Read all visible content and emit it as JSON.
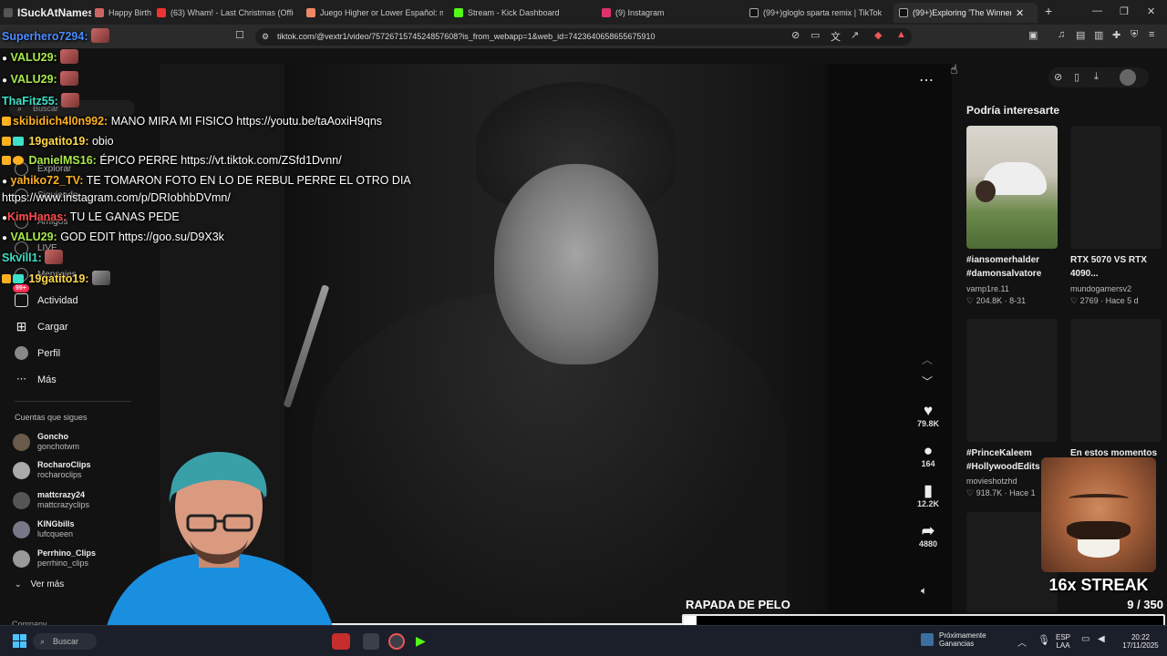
{
  "browser": {
    "tabs": [
      {
        "label": "ISuckAtNames:",
        "color": "#f0f0f0"
      },
      {
        "label": "Happy Birth",
        "color": "#c9c9c9"
      },
      {
        "label": "(63) Wham! - Last Christmas (Officia",
        "color": "#e33"
      },
      {
        "label": "Juego Higher or Lower Español: más",
        "color": "#e86"
      },
      {
        "label": "Stream - Kick Dashboard",
        "color": "#53fc18"
      },
      {
        "label": "(9) Instagram",
        "color": "#e1306c"
      },
      {
        "label": "(99+)gloglo sparta remix | TikTok",
        "color": "#fff"
      },
      {
        "label": "(99+)Exploring 'The Winner",
        "color": "#fff"
      }
    ],
    "url": "tiktok.com/@vextr1/video/7572671574524857608?is_from_webapp=1&web_id=7423640658655675910"
  },
  "chat": [
    {
      "user": "Superhero7294:",
      "color": "#4d8cff",
      "text": ""
    },
    {
      "user": "VALU29:",
      "color": "#a8e84a",
      "text": ""
    },
    {
      "user": "VALU29:",
      "color": "#a8e84a",
      "text": ""
    },
    {
      "user": "ThaFitz55:",
      "color": "#3de0c8",
      "text": ""
    },
    {
      "user": "skibidich4l0n992:",
      "color": "#ffb020",
      "text": "MANO MIRA MI FISICO https://youtu.be/taAoxiH9qns"
    },
    {
      "user": "19gatito19:",
      "color": "#ffd84a",
      "text": "obio"
    },
    {
      "user": "DanielMS16:",
      "color": "#a8e84a",
      "text": "ÉPICO PERRE https://vt.tiktok.com/ZSfd1Dvnn/"
    },
    {
      "user": "yahiko72_TV:",
      "color": "#ffb020",
      "text": "TE TOMARON FOTO EN LO DE REBUL PERRE EL OTRO DIA"
    },
    {
      "user": "",
      "color": "#fff",
      "text": "https://www.instagram.com/p/DRIobhbDVmn/"
    },
    {
      "user": "KimHanas:",
      "color": "#ff4a4a",
      "text": "TU LE GANAS PEDE"
    },
    {
      "user": "VALU29:",
      "color": "#a8e84a",
      "text": "GOD EDIT https://goo.su/D9X3k"
    },
    {
      "user": "Skvill1:",
      "color": "#3de0c8",
      "text": ""
    },
    {
      "user": "19gatito19:",
      "color": "#ffd84a",
      "text": ""
    }
  ],
  "sidebar": {
    "search_placeholder": "Buscar",
    "items": [
      {
        "label": "Explorar"
      },
      {
        "label": "Siguiendo"
      },
      {
        "label": "Amigos"
      },
      {
        "label": "LIVE"
      },
      {
        "label": "Mensajes"
      },
      {
        "label": "Actividad",
        "badge": "99+"
      },
      {
        "label": "Cargar"
      },
      {
        "label": "Perfil"
      },
      {
        "label": "Más"
      }
    ],
    "following_header": "Cuentas que sigues",
    "accounts": [
      {
        "name": "Goncho",
        "handle": "gonchotwm"
      },
      {
        "name": "RocharoClips",
        "handle": "rocharoclips"
      },
      {
        "name": "mattcrazy24",
        "handle": "mattcrazyclips"
      },
      {
        "name": "KINGbills",
        "handle": "lufcqueen"
      },
      {
        "name": "Perrhino_Clips",
        "handle": "perrhino_clips"
      }
    ],
    "see_more": "Ver más",
    "footer": "Company"
  },
  "video": {
    "progress": 0.98,
    "likes": "79.8K",
    "comments": "164",
    "saves": "12.2K",
    "shares": "4880"
  },
  "suggestions": {
    "header": "Podría interesarte",
    "cards": [
      {
        "title_1": "#iansomerhalder",
        "title_2": "#damonsalvatore",
        "author": "vamp1re.11",
        "stats": "♡ 204.8K · 8-31"
      },
      {
        "title_1": "RTX 5070 VS RTX",
        "title_2": "4090...",
        "author": "mundogamersv2",
        "stats": "♡ 2769 · Hace 5 d"
      },
      {
        "title_1": "#PrinceKaleem",
        "title_2": "#HollywoodEdits",
        "author": "movieshotzhd",
        "stats": "♡ 918.7K · Hace 1"
      },
      {
        "title_1": "En estos momentos",
        "title_2": "",
        "author": "",
        "stats": ""
      }
    ]
  },
  "overlay": {
    "streak": "16x STREAK",
    "goal_label": "RAPADA DE PELO",
    "goal_count": "9  / 350",
    "goal_current": 9,
    "goal_target": 350
  },
  "taskbar": {
    "search": "Buscar",
    "news_1": "Próximamente",
    "news_2": "Ganancias",
    "lang_1": "ESP",
    "lang_2": "LAA",
    "time": "20:22",
    "date": "17/11/2025"
  }
}
